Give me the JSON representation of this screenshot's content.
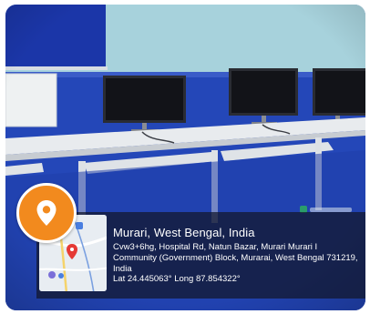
{
  "geotag": {
    "title": "Murari, West Bengal, India",
    "address": "Cvw3+6hg, Hospital Rd, Natun Bazar, Murari Murari I Community (Government) Block, Murarai, West Bengal 731219, India",
    "coordinates": "Lat 24.445063° Long 87.854322°",
    "map_icon": "map-pin-icon",
    "badge_color": "#f28a1e"
  }
}
